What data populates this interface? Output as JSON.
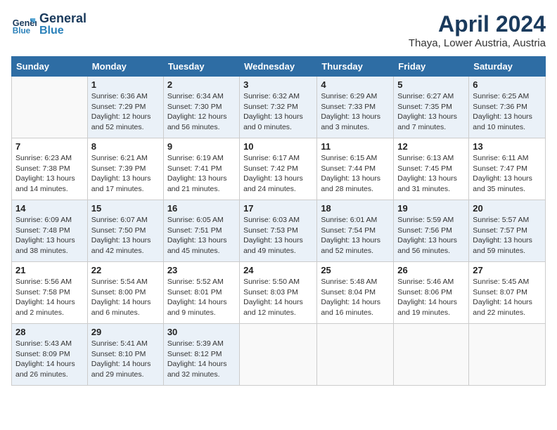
{
  "header": {
    "logo_line1": "General",
    "logo_line2": "Blue",
    "month": "April 2024",
    "location": "Thaya, Lower Austria, Austria"
  },
  "weekdays": [
    "Sunday",
    "Monday",
    "Tuesday",
    "Wednesday",
    "Thursday",
    "Friday",
    "Saturday"
  ],
  "weeks": [
    [
      {
        "day": "",
        "info": ""
      },
      {
        "day": "1",
        "info": "Sunrise: 6:36 AM\nSunset: 7:29 PM\nDaylight: 12 hours\nand 52 minutes."
      },
      {
        "day": "2",
        "info": "Sunrise: 6:34 AM\nSunset: 7:30 PM\nDaylight: 12 hours\nand 56 minutes."
      },
      {
        "day": "3",
        "info": "Sunrise: 6:32 AM\nSunset: 7:32 PM\nDaylight: 13 hours\nand 0 minutes."
      },
      {
        "day": "4",
        "info": "Sunrise: 6:29 AM\nSunset: 7:33 PM\nDaylight: 13 hours\nand 3 minutes."
      },
      {
        "day": "5",
        "info": "Sunrise: 6:27 AM\nSunset: 7:35 PM\nDaylight: 13 hours\nand 7 minutes."
      },
      {
        "day": "6",
        "info": "Sunrise: 6:25 AM\nSunset: 7:36 PM\nDaylight: 13 hours\nand 10 minutes."
      }
    ],
    [
      {
        "day": "7",
        "info": "Sunrise: 6:23 AM\nSunset: 7:38 PM\nDaylight: 13 hours\nand 14 minutes."
      },
      {
        "day": "8",
        "info": "Sunrise: 6:21 AM\nSunset: 7:39 PM\nDaylight: 13 hours\nand 17 minutes."
      },
      {
        "day": "9",
        "info": "Sunrise: 6:19 AM\nSunset: 7:41 PM\nDaylight: 13 hours\nand 21 minutes."
      },
      {
        "day": "10",
        "info": "Sunrise: 6:17 AM\nSunset: 7:42 PM\nDaylight: 13 hours\nand 24 minutes."
      },
      {
        "day": "11",
        "info": "Sunrise: 6:15 AM\nSunset: 7:44 PM\nDaylight: 13 hours\nand 28 minutes."
      },
      {
        "day": "12",
        "info": "Sunrise: 6:13 AM\nSunset: 7:45 PM\nDaylight: 13 hours\nand 31 minutes."
      },
      {
        "day": "13",
        "info": "Sunrise: 6:11 AM\nSunset: 7:47 PM\nDaylight: 13 hours\nand 35 minutes."
      }
    ],
    [
      {
        "day": "14",
        "info": "Sunrise: 6:09 AM\nSunset: 7:48 PM\nDaylight: 13 hours\nand 38 minutes."
      },
      {
        "day": "15",
        "info": "Sunrise: 6:07 AM\nSunset: 7:50 PM\nDaylight: 13 hours\nand 42 minutes."
      },
      {
        "day": "16",
        "info": "Sunrise: 6:05 AM\nSunset: 7:51 PM\nDaylight: 13 hours\nand 45 minutes."
      },
      {
        "day": "17",
        "info": "Sunrise: 6:03 AM\nSunset: 7:53 PM\nDaylight: 13 hours\nand 49 minutes."
      },
      {
        "day": "18",
        "info": "Sunrise: 6:01 AM\nSunset: 7:54 PM\nDaylight: 13 hours\nand 52 minutes."
      },
      {
        "day": "19",
        "info": "Sunrise: 5:59 AM\nSunset: 7:56 PM\nDaylight: 13 hours\nand 56 minutes."
      },
      {
        "day": "20",
        "info": "Sunrise: 5:57 AM\nSunset: 7:57 PM\nDaylight: 13 hours\nand 59 minutes."
      }
    ],
    [
      {
        "day": "21",
        "info": "Sunrise: 5:56 AM\nSunset: 7:58 PM\nDaylight: 14 hours\nand 2 minutes."
      },
      {
        "day": "22",
        "info": "Sunrise: 5:54 AM\nSunset: 8:00 PM\nDaylight: 14 hours\nand 6 minutes."
      },
      {
        "day": "23",
        "info": "Sunrise: 5:52 AM\nSunset: 8:01 PM\nDaylight: 14 hours\nand 9 minutes."
      },
      {
        "day": "24",
        "info": "Sunrise: 5:50 AM\nSunset: 8:03 PM\nDaylight: 14 hours\nand 12 minutes."
      },
      {
        "day": "25",
        "info": "Sunrise: 5:48 AM\nSunset: 8:04 PM\nDaylight: 14 hours\nand 16 minutes."
      },
      {
        "day": "26",
        "info": "Sunrise: 5:46 AM\nSunset: 8:06 PM\nDaylight: 14 hours\nand 19 minutes."
      },
      {
        "day": "27",
        "info": "Sunrise: 5:45 AM\nSunset: 8:07 PM\nDaylight: 14 hours\nand 22 minutes."
      }
    ],
    [
      {
        "day": "28",
        "info": "Sunrise: 5:43 AM\nSunset: 8:09 PM\nDaylight: 14 hours\nand 26 minutes."
      },
      {
        "day": "29",
        "info": "Sunrise: 5:41 AM\nSunset: 8:10 PM\nDaylight: 14 hours\nand 29 minutes."
      },
      {
        "day": "30",
        "info": "Sunrise: 5:39 AM\nSunset: 8:12 PM\nDaylight: 14 hours\nand 32 minutes."
      },
      {
        "day": "",
        "info": ""
      },
      {
        "day": "",
        "info": ""
      },
      {
        "day": "",
        "info": ""
      },
      {
        "day": "",
        "info": ""
      }
    ]
  ]
}
